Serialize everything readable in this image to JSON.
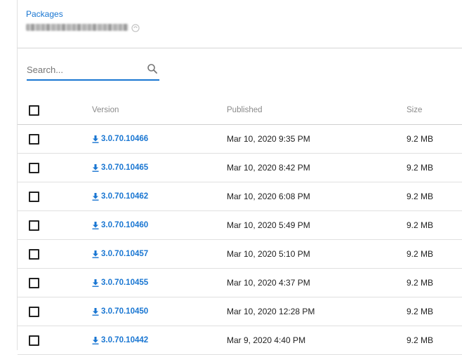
{
  "header": {
    "breadcrumb": "Packages",
    "package_name": "[blurred package name]"
  },
  "search": {
    "placeholder": "Search...",
    "value": ""
  },
  "table": {
    "columns": {
      "version": "Version",
      "published": "Published",
      "size": "Size"
    },
    "rows": [
      {
        "version": "3.0.70.10466",
        "published": "Mar 10, 2020 9:35 PM",
        "size": "9.2 MB"
      },
      {
        "version": "3.0.70.10465",
        "published": "Mar 10, 2020 8:42 PM",
        "size": "9.2 MB"
      },
      {
        "version": "3.0.70.10462",
        "published": "Mar 10, 2020 6:08 PM",
        "size": "9.2 MB"
      },
      {
        "version": "3.0.70.10460",
        "published": "Mar 10, 2020 5:49 PM",
        "size": "9.2 MB"
      },
      {
        "version": "3.0.70.10457",
        "published": "Mar 10, 2020 5:10 PM",
        "size": "9.2 MB"
      },
      {
        "version": "3.0.70.10455",
        "published": "Mar 10, 2020 4:37 PM",
        "size": "9.2 MB"
      },
      {
        "version": "3.0.70.10450",
        "published": "Mar 10, 2020 12:28 PM",
        "size": "9.2 MB"
      },
      {
        "version": "3.0.70.10442",
        "published": "Mar 9, 2020 4:40 PM",
        "size": "9.2 MB"
      }
    ]
  },
  "colors": {
    "accent": "#1976d2",
    "divider": "#e0e0e0",
    "header_text": "#8a8a8a"
  },
  "icons": {
    "search": "search-icon",
    "download": "download-icon",
    "copy": "copy-icon"
  }
}
